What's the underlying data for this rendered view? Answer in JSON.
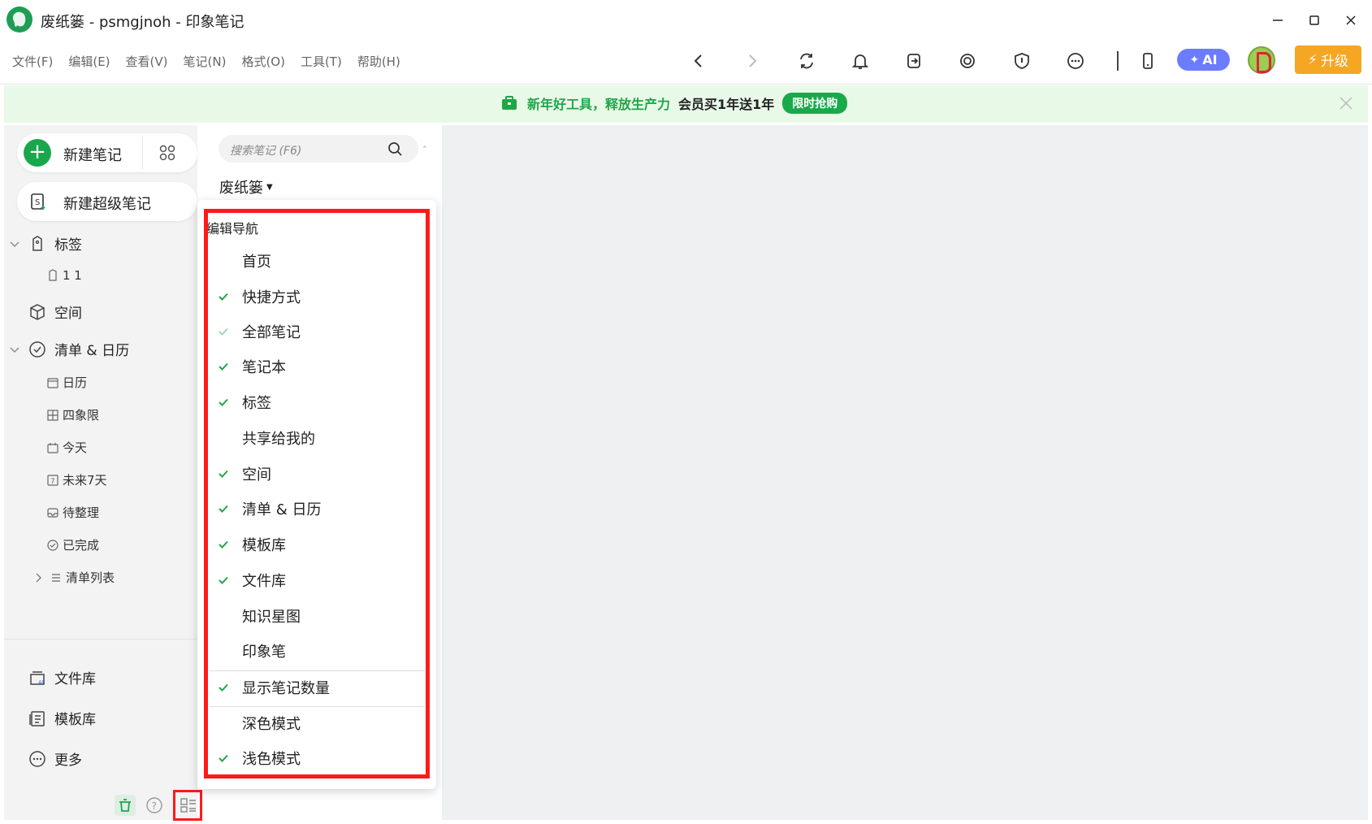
{
  "window": {
    "title": "废纸篓 - psmgjnoh - 印象笔记"
  },
  "menu": [
    "文件(F)",
    "编辑(E)",
    "查看(V)",
    "笔记(N)",
    "格式(O)",
    "工具(T)",
    "帮助(H)"
  ],
  "toolbar": {
    "ai_label": "AI",
    "upgrade_label": "升级"
  },
  "banner": {
    "text_green": "新年好工具，释放生产力",
    "text_dark": "会员买1年送1年",
    "button": "限时抢购"
  },
  "sidebar": {
    "new_note": "新建笔记",
    "new_super_note": "新建超级笔记",
    "tags": "标签",
    "tag_item": "1 1",
    "spaces": "空间",
    "todo_calendar": "清单 & 日历",
    "sub_items": [
      "日历",
      "四象限",
      "今天",
      "未来7天",
      "待整理",
      "已完成",
      "清单列表"
    ],
    "file_library": "文件库",
    "template_library": "模板库",
    "more": "更多"
  },
  "notelist": {
    "search_placeholder": "搜索笔记 (F6)",
    "notebook_title": "废纸篓"
  },
  "popup": {
    "header": "编辑导航",
    "items": [
      {
        "label": "首页",
        "checked": "none"
      },
      {
        "label": "快捷方式",
        "checked": "yes"
      },
      {
        "label": "全部笔记",
        "checked": "disabled"
      },
      {
        "label": "笔记本",
        "checked": "yes"
      },
      {
        "label": "标签",
        "checked": "yes"
      },
      {
        "label": "共享给我的",
        "checked": "none"
      },
      {
        "label": "空间",
        "checked": "yes"
      },
      {
        "label": "清单 & 日历",
        "checked": "yes"
      },
      {
        "label": "模板库",
        "checked": "yes"
      },
      {
        "label": "文件库",
        "checked": "yes"
      },
      {
        "label": "知识星图",
        "checked": "none"
      },
      {
        "label": "印象笔",
        "checked": "none"
      },
      {
        "label": "显示笔记数量",
        "checked": "yes"
      },
      {
        "label": "深色模式",
        "checked": "none"
      },
      {
        "label": "浅色模式",
        "checked": "yes"
      }
    ]
  },
  "colors": {
    "brand_green": "#1aa74c",
    "highlight_red": "#ff1a1a",
    "upgrade_orange": "#f5a623",
    "ai_purple": "#6b7cff"
  }
}
